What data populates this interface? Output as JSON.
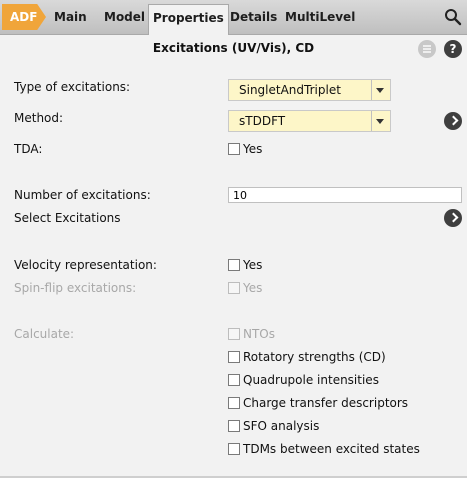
{
  "tabs": [
    {
      "label": "ADF"
    },
    {
      "label": "Main"
    },
    {
      "label": "Model"
    },
    {
      "label": "Properties"
    },
    {
      "label": "Details"
    },
    {
      "label": "MultiLevel"
    }
  ],
  "header": {
    "title": "Excitations (UV/Vis), CD",
    "menu_icon": "menu-icon",
    "help_label": "?"
  },
  "form": {
    "type_label": "Type of excitations:",
    "type_value": "SingletAndTriplet",
    "method_label": "Method:",
    "method_value": "sTDDFT",
    "tda_label": "TDA:",
    "tda_check_label": "Yes",
    "num_label": "Number of excitations:",
    "num_value": "10",
    "select_label": "Select Excitations",
    "velocity_label": "Velocity representation:",
    "velocity_check_label": "Yes",
    "spinflip_label": "Spin-flip excitations:",
    "spinflip_check_label": "Yes",
    "calculate_label": "Calculate:",
    "calculate_options": [
      {
        "label": "NTOs",
        "enabled": false
      },
      {
        "label": "Rotatory strengths (CD)",
        "enabled": true
      },
      {
        "label": "Quadrupole intensities",
        "enabled": true
      },
      {
        "label": "Charge transfer descriptors",
        "enabled": true
      },
      {
        "label": "SFO analysis",
        "enabled": true
      },
      {
        "label": "TDMs between excited states",
        "enabled": true
      }
    ]
  },
  "colors": {
    "accent": "#f0a53a",
    "select_bg": "#fdf6c8",
    "disabled_text": "#a8a8a8"
  }
}
